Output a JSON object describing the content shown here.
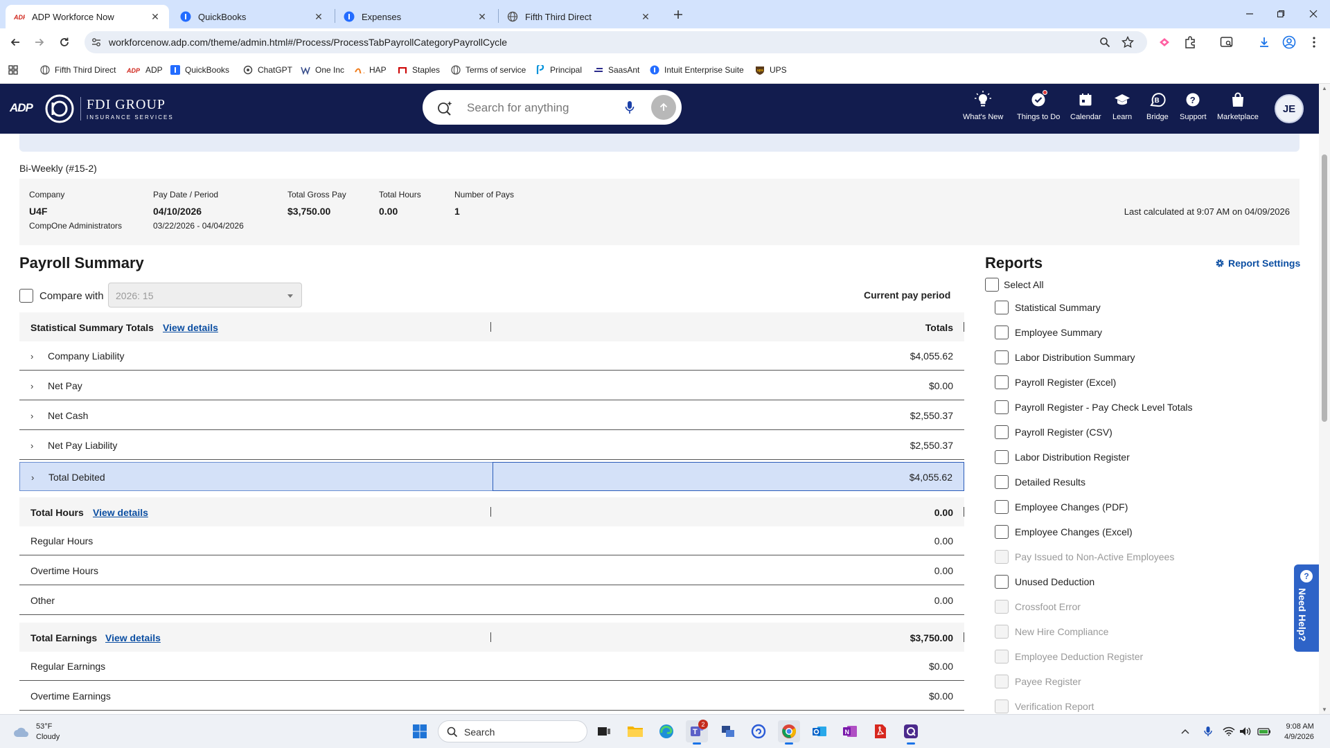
{
  "browser": {
    "tabs": [
      {
        "title": "ADP Workforce Now",
        "icon": "adp-icon",
        "active": true
      },
      {
        "title": "QuickBooks",
        "icon": "intuit-icon",
        "active": false
      },
      {
        "title": "Expenses",
        "icon": "intuit-icon",
        "active": false
      },
      {
        "title": "Fifth Third Direct",
        "icon": "globe-icon",
        "active": false
      }
    ],
    "url": "workforcenow.adp.com/theme/admin.html#/Process/ProcessTabPayrollCategoryPayrollCycle",
    "bookmarks": [
      {
        "label": "Fifth Third Direct",
        "icon": "globe-icon"
      },
      {
        "label": "ADP",
        "icon": "adp-icon"
      },
      {
        "label": "QuickBooks",
        "icon": "quickbooks-icon"
      },
      {
        "label": "ChatGPT",
        "icon": "chatgpt-icon"
      },
      {
        "label": "One Inc",
        "icon": "oneinc-icon"
      },
      {
        "label": "HAP",
        "icon": "hap-icon"
      },
      {
        "label": "Staples",
        "icon": "staples-icon"
      },
      {
        "label": "Terms of service",
        "icon": "globe-icon"
      },
      {
        "label": "Principal",
        "icon": "principal-icon"
      },
      {
        "label": "SaasAnt",
        "icon": "saasant-icon"
      },
      {
        "label": "Intuit Enterprise Suite",
        "icon": "intuit-icon"
      },
      {
        "label": "UPS",
        "icon": "ups-icon"
      }
    ]
  },
  "header": {
    "logo": "ADP",
    "company_name": "FDI GROUP",
    "company_tagline": "INSURANCE SERVICES",
    "search_placeholder": "Search for anything",
    "nav": [
      {
        "label": "What's New",
        "icon": "lightbulb-icon"
      },
      {
        "label": "Things to Do",
        "icon": "check-badge-icon"
      },
      {
        "label": "Calendar",
        "icon": "calendar-icon"
      },
      {
        "label": "Learn",
        "icon": "graduation-cap-icon"
      },
      {
        "label": "Bridge",
        "icon": "bridge-icon"
      },
      {
        "label": "Support",
        "icon": "question-icon"
      },
      {
        "label": "Marketplace",
        "icon": "shopping-bag-icon"
      }
    ],
    "avatar_initials": "JE"
  },
  "cycle": {
    "name": "Bi-Weekly (#15-2)",
    "company_label": "Company",
    "company_code": "U4F",
    "company_name": "CompOne Administrators",
    "paydate_label": "Pay Date / Period",
    "pay_date": "04/10/2026",
    "period": "03/22/2026 - 04/04/2026",
    "gross_label": "Total Gross Pay",
    "gross": "$3,750.00",
    "hours_label": "Total Hours",
    "hours": "0.00",
    "pays_label": "Number of Pays",
    "pays": "1",
    "last_calculated": "Last calculated at 9:07 AM on 04/09/2026"
  },
  "summary": {
    "title": "Payroll Summary",
    "compare_label": "Compare with",
    "compare_value": "2026: 15",
    "current_period_label": "Current pay period",
    "stat_section": {
      "title": "Statistical Summary Totals",
      "link": "View details",
      "total": "Totals"
    },
    "stat_rows": [
      {
        "label": "Company Liability",
        "value": "$4,055.62"
      },
      {
        "label": "Net Pay",
        "value": "$0.00"
      },
      {
        "label": "Net Cash",
        "value": "$2,550.37"
      },
      {
        "label": "Net Pay Liability",
        "value": "$2,550.37"
      },
      {
        "label": "Total Debited",
        "value": "$4,055.62"
      }
    ],
    "hours_section": {
      "title": "Total Hours",
      "link": "View details",
      "total": "0.00"
    },
    "hours_rows": [
      {
        "label": "Regular Hours",
        "value": "0.00"
      },
      {
        "label": "Overtime Hours",
        "value": "0.00"
      },
      {
        "label": "Other",
        "value": "0.00"
      }
    ],
    "earnings_section": {
      "title": "Total Earnings",
      "link": "View details",
      "total": "$3,750.00"
    },
    "earnings_rows": [
      {
        "label": "Regular Earnings",
        "value": "$0.00"
      },
      {
        "label": "Overtime Earnings",
        "value": "$0.00"
      }
    ]
  },
  "reports": {
    "title": "Reports",
    "settings_label": "Report Settings",
    "select_all": "Select All",
    "items": [
      {
        "label": "Statistical Summary",
        "disabled": false
      },
      {
        "label": "Employee Summary",
        "disabled": false
      },
      {
        "label": "Labor Distribution Summary",
        "disabled": false
      },
      {
        "label": "Payroll Register (Excel)",
        "disabled": false
      },
      {
        "label": "Payroll Register - Pay Check Level Totals",
        "disabled": false
      },
      {
        "label": "Payroll Register (CSV)",
        "disabled": false
      },
      {
        "label": "Labor Distribution Register",
        "disabled": false
      },
      {
        "label": "Detailed Results",
        "disabled": false
      },
      {
        "label": "Employee Changes (PDF)",
        "disabled": false
      },
      {
        "label": "Employee Changes (Excel)",
        "disabled": false
      },
      {
        "label": "Pay Issued to Non-Active Employees",
        "disabled": true
      },
      {
        "label": "Unused Deduction",
        "disabled": false
      },
      {
        "label": "Crossfoot Error",
        "disabled": true
      },
      {
        "label": "New Hire Compliance",
        "disabled": true
      },
      {
        "label": "Employee Deduction Register",
        "disabled": true
      },
      {
        "label": "Payee Register",
        "disabled": true
      },
      {
        "label": "Verification Report",
        "disabled": true
      }
    ]
  },
  "need_help": "Need Help?",
  "taskbar": {
    "weather_temp": "53°F",
    "weather_desc": "Cloudy",
    "search_label": "Search",
    "teams_badge": "2",
    "time": "9:08 AM",
    "date": "4/9/2026"
  },
  "colors": {
    "adp_navy": "#121c4e",
    "link_blue": "#0b4ea2",
    "selection": "#d4e1f8",
    "tab_strip": "#d3e3fd"
  }
}
